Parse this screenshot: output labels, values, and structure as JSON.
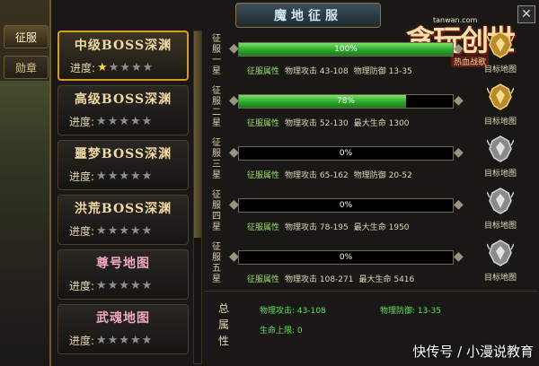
{
  "outer_tabs": [
    {
      "label": "征服",
      "active": true
    },
    {
      "label": "勋章",
      "active": false
    }
  ],
  "window": {
    "title": "魔地征服",
    "close_label": "✕"
  },
  "logo": {
    "main": "贪玩创世",
    "url": "tanwan.com",
    "sub": "热血战歌"
  },
  "zones": [
    {
      "name": "中级BOSS深渊",
      "progress_label": "进度:",
      "stars_filled": 1,
      "stars_total": 5,
      "color": "gold",
      "selected": true
    },
    {
      "name": "高级BOSS深渊",
      "progress_label": "进度:",
      "stars_filled": 0,
      "stars_total": 5,
      "color": "gold",
      "selected": false
    },
    {
      "name": "噩梦BOSS深渊",
      "progress_label": "进度:",
      "stars_filled": 0,
      "stars_total": 5,
      "color": "gold",
      "selected": false
    },
    {
      "name": "洪荒BOSS深渊",
      "progress_label": "进度:",
      "stars_filled": 0,
      "stars_total": 5,
      "color": "gold",
      "selected": false
    },
    {
      "name": "尊号地图",
      "progress_label": "进度:",
      "stars_filled": 0,
      "stars_total": 5,
      "color": "pink",
      "selected": false
    },
    {
      "name": "武魂地图",
      "progress_label": "进度:",
      "stars_filled": 0,
      "stars_total": 5,
      "color": "pink",
      "selected": false
    }
  ],
  "stages": [
    {
      "label": "征服一星",
      "progress": 1.0,
      "percent_text": "100%",
      "attr_label": "征服属性",
      "attrs": [
        "物理攻击 43-108",
        "物理防御 13-35"
      ],
      "target_label": "目标地图",
      "crest": "gold"
    },
    {
      "label": "征服二星",
      "progress": 0.78,
      "percent_text": "78%",
      "attr_label": "征服属性",
      "attrs": [
        "物理攻击 52-130",
        "最大生命 1300"
      ],
      "target_label": "目标地图",
      "crest": "gold"
    },
    {
      "label": "征服三星",
      "progress": 0.0,
      "percent_text": "0%",
      "attr_label": "征服属性",
      "attrs": [
        "物理攻击 65-162",
        "物理防御 20-52"
      ],
      "target_label": "目标地图",
      "crest": "silver"
    },
    {
      "label": "征服四星",
      "progress": 0.0,
      "percent_text": "0%",
      "attr_label": "征服属性",
      "attrs": [
        "物理攻击 78-195",
        "最大生命 1950"
      ],
      "target_label": "目标地图",
      "crest": "silver"
    },
    {
      "label": "征服五星",
      "progress": 0.0,
      "percent_text": "0%",
      "attr_label": "征服属性",
      "attrs": [
        "物理攻击 108-271",
        "最大生命 5416"
      ],
      "target_label": "目标地图",
      "crest": "silver"
    }
  ],
  "total": {
    "title": "总属性",
    "physical_attack": "物理攻击: 43-108",
    "physical_defense": "物理防御: 13-35",
    "max_hp": "生命上限: 0"
  },
  "watermark": "快传号 / 小漫说教育",
  "colors": {
    "accent_gold": "#d79a2a",
    "bar_green": "#2aa82b",
    "attr_green": "#5fe35c",
    "pink_text": "#f1a6c6"
  }
}
